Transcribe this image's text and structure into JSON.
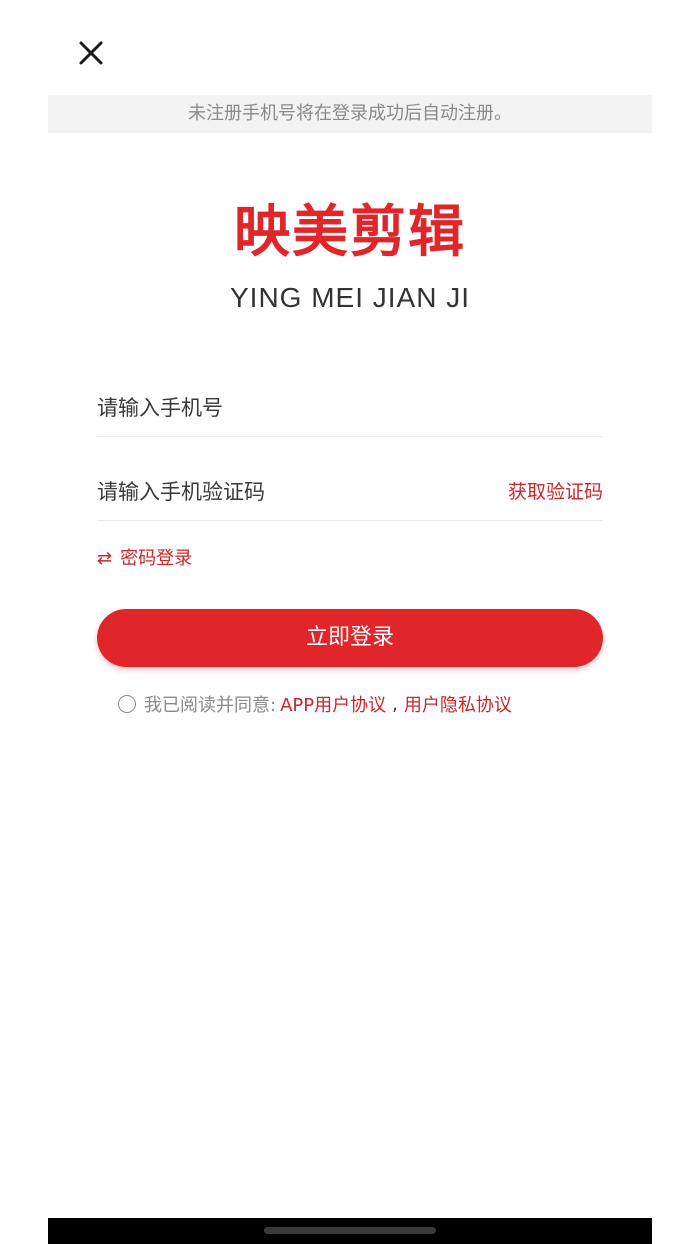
{
  "header": {
    "close_icon": "close-icon"
  },
  "notice": "未注册手机号将在登录成功后自动注册。",
  "logo": {
    "cn": "映美剪辑",
    "en": "YING MEI JIAN JI"
  },
  "form": {
    "phone_placeholder": "请输入手机号",
    "code_placeholder": "请输入手机验证码",
    "get_code_label": "获取验证码",
    "password_login_label": "密码登录",
    "password_login_icon": "swap-icon",
    "submit_label": "立即登录"
  },
  "agreement": {
    "prefix": "我已阅读并同意:",
    "link1": "APP用户协议",
    "separator": ",",
    "link2": "用户隐私协议"
  },
  "colors": {
    "accent": "#e0262b",
    "link": "#c9272c",
    "notice_bg": "#f3f3f3"
  }
}
